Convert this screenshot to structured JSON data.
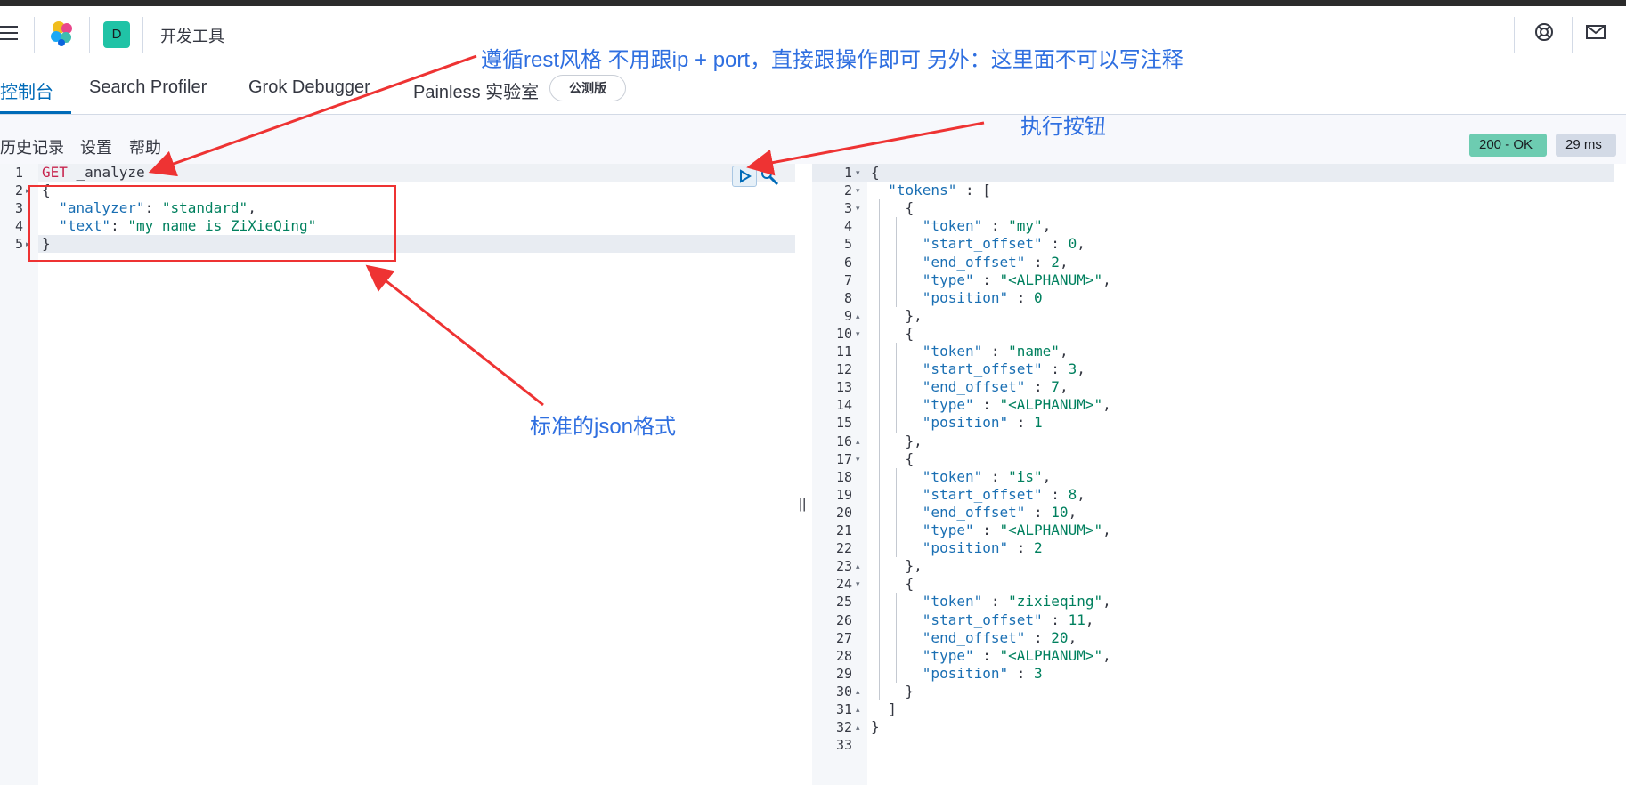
{
  "header": {
    "space_letter": "D",
    "app_title": "开发工具",
    "icons": [
      "menu-icon",
      "elastic-logo-icon",
      "help-icon",
      "mail-icon"
    ]
  },
  "tabs": [
    {
      "label": "控制台",
      "active": true
    },
    {
      "label": "Search Profiler",
      "active": false
    },
    {
      "label": "Grok Debugger",
      "active": false
    },
    {
      "label": "Painless 实验室",
      "active": false
    }
  ],
  "beta_badge": "公测版",
  "toolbar": {
    "history": "历史记录",
    "settings": "设置",
    "help": "帮助",
    "status": "200 - OK",
    "duration": "29 ms",
    "status_color": "#6dccb1"
  },
  "request": {
    "method": "GET",
    "path": "_analyze",
    "lines": [
      [
        "GET",
        " _analyze"
      ],
      [
        "{"
      ],
      [
        "  \"analyzer\"",
        ": ",
        "\"standard\"",
        ","
      ],
      [
        "  \"text\"",
        ": ",
        "\"my name is ZiXieQing\""
      ],
      [
        "}"
      ]
    ]
  },
  "response": {
    "lines": [
      "{",
      "  \"tokens\" : [",
      "    {",
      "      \"token\" : \"my\",",
      "      \"start_offset\" : 0,",
      "      \"end_offset\" : 2,",
      "      \"type\" : \"<ALPHANUM>\",",
      "      \"position\" : 0",
      "    },",
      "    {",
      "      \"token\" : \"name\",",
      "      \"start_offset\" : 3,",
      "      \"end_offset\" : 7,",
      "      \"type\" : \"<ALPHANUM>\",",
      "      \"position\" : 1",
      "    },",
      "    {",
      "      \"token\" : \"is\",",
      "      \"start_offset\" : 8,",
      "      \"end_offset\" : 10,",
      "      \"type\" : \"<ALPHANUM>\",",
      "      \"position\" : 2",
      "    },",
      "    {",
      "      \"token\" : \"zixieqing\",",
      "      \"start_offset\" : 11,",
      "      \"end_offset\" : 20,",
      "      \"type\" : \"<ALPHANUM>\",",
      "      \"position\" : 3",
      "    }",
      "  ]",
      "}",
      ""
    ]
  },
  "annotations": {
    "rest_note": "遵循rest风格 不用跟ip + port，直接跟操作即可   另外：这里面不可以写注释",
    "run_note": "执行按钮",
    "json_note": "标准的json格式",
    "color": "#ee3333"
  },
  "divider_glyph": "||"
}
